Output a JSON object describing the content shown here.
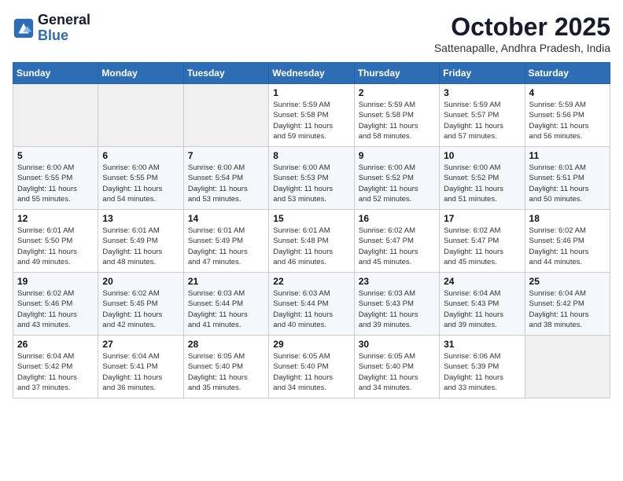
{
  "logo": {
    "line1": "General",
    "line2": "Blue"
  },
  "title": "October 2025",
  "subtitle": "Sattenapalle, Andhra Pradesh, India",
  "days_of_week": [
    "Sunday",
    "Monday",
    "Tuesday",
    "Wednesday",
    "Thursday",
    "Friday",
    "Saturday"
  ],
  "weeks": [
    [
      {
        "day": "",
        "info": ""
      },
      {
        "day": "",
        "info": ""
      },
      {
        "day": "",
        "info": ""
      },
      {
        "day": "1",
        "info": "Sunrise: 5:59 AM\nSunset: 5:58 PM\nDaylight: 11 hours\nand 59 minutes."
      },
      {
        "day": "2",
        "info": "Sunrise: 5:59 AM\nSunset: 5:58 PM\nDaylight: 11 hours\nand 58 minutes."
      },
      {
        "day": "3",
        "info": "Sunrise: 5:59 AM\nSunset: 5:57 PM\nDaylight: 11 hours\nand 57 minutes."
      },
      {
        "day": "4",
        "info": "Sunrise: 5:59 AM\nSunset: 5:56 PM\nDaylight: 11 hours\nand 56 minutes."
      }
    ],
    [
      {
        "day": "5",
        "info": "Sunrise: 6:00 AM\nSunset: 5:55 PM\nDaylight: 11 hours\nand 55 minutes."
      },
      {
        "day": "6",
        "info": "Sunrise: 6:00 AM\nSunset: 5:55 PM\nDaylight: 11 hours\nand 54 minutes."
      },
      {
        "day": "7",
        "info": "Sunrise: 6:00 AM\nSunset: 5:54 PM\nDaylight: 11 hours\nand 53 minutes."
      },
      {
        "day": "8",
        "info": "Sunrise: 6:00 AM\nSunset: 5:53 PM\nDaylight: 11 hours\nand 53 minutes."
      },
      {
        "day": "9",
        "info": "Sunrise: 6:00 AM\nSunset: 5:52 PM\nDaylight: 11 hours\nand 52 minutes."
      },
      {
        "day": "10",
        "info": "Sunrise: 6:00 AM\nSunset: 5:52 PM\nDaylight: 11 hours\nand 51 minutes."
      },
      {
        "day": "11",
        "info": "Sunrise: 6:01 AM\nSunset: 5:51 PM\nDaylight: 11 hours\nand 50 minutes."
      }
    ],
    [
      {
        "day": "12",
        "info": "Sunrise: 6:01 AM\nSunset: 5:50 PM\nDaylight: 11 hours\nand 49 minutes."
      },
      {
        "day": "13",
        "info": "Sunrise: 6:01 AM\nSunset: 5:49 PM\nDaylight: 11 hours\nand 48 minutes."
      },
      {
        "day": "14",
        "info": "Sunrise: 6:01 AM\nSunset: 5:49 PM\nDaylight: 11 hours\nand 47 minutes."
      },
      {
        "day": "15",
        "info": "Sunrise: 6:01 AM\nSunset: 5:48 PM\nDaylight: 11 hours\nand 46 minutes."
      },
      {
        "day": "16",
        "info": "Sunrise: 6:02 AM\nSunset: 5:47 PM\nDaylight: 11 hours\nand 45 minutes."
      },
      {
        "day": "17",
        "info": "Sunrise: 6:02 AM\nSunset: 5:47 PM\nDaylight: 11 hours\nand 45 minutes."
      },
      {
        "day": "18",
        "info": "Sunrise: 6:02 AM\nSunset: 5:46 PM\nDaylight: 11 hours\nand 44 minutes."
      }
    ],
    [
      {
        "day": "19",
        "info": "Sunrise: 6:02 AM\nSunset: 5:46 PM\nDaylight: 11 hours\nand 43 minutes."
      },
      {
        "day": "20",
        "info": "Sunrise: 6:02 AM\nSunset: 5:45 PM\nDaylight: 11 hours\nand 42 minutes."
      },
      {
        "day": "21",
        "info": "Sunrise: 6:03 AM\nSunset: 5:44 PM\nDaylight: 11 hours\nand 41 minutes."
      },
      {
        "day": "22",
        "info": "Sunrise: 6:03 AM\nSunset: 5:44 PM\nDaylight: 11 hours\nand 40 minutes."
      },
      {
        "day": "23",
        "info": "Sunrise: 6:03 AM\nSunset: 5:43 PM\nDaylight: 11 hours\nand 39 minutes."
      },
      {
        "day": "24",
        "info": "Sunrise: 6:04 AM\nSunset: 5:43 PM\nDaylight: 11 hours\nand 39 minutes."
      },
      {
        "day": "25",
        "info": "Sunrise: 6:04 AM\nSunset: 5:42 PM\nDaylight: 11 hours\nand 38 minutes."
      }
    ],
    [
      {
        "day": "26",
        "info": "Sunrise: 6:04 AM\nSunset: 5:42 PM\nDaylight: 11 hours\nand 37 minutes."
      },
      {
        "day": "27",
        "info": "Sunrise: 6:04 AM\nSunset: 5:41 PM\nDaylight: 11 hours\nand 36 minutes."
      },
      {
        "day": "28",
        "info": "Sunrise: 6:05 AM\nSunset: 5:40 PM\nDaylight: 11 hours\nand 35 minutes."
      },
      {
        "day": "29",
        "info": "Sunrise: 6:05 AM\nSunset: 5:40 PM\nDaylight: 11 hours\nand 34 minutes."
      },
      {
        "day": "30",
        "info": "Sunrise: 6:05 AM\nSunset: 5:40 PM\nDaylight: 11 hours\nand 34 minutes."
      },
      {
        "day": "31",
        "info": "Sunrise: 6:06 AM\nSunset: 5:39 PM\nDaylight: 11 hours\nand 33 minutes."
      },
      {
        "day": "",
        "info": ""
      }
    ]
  ]
}
